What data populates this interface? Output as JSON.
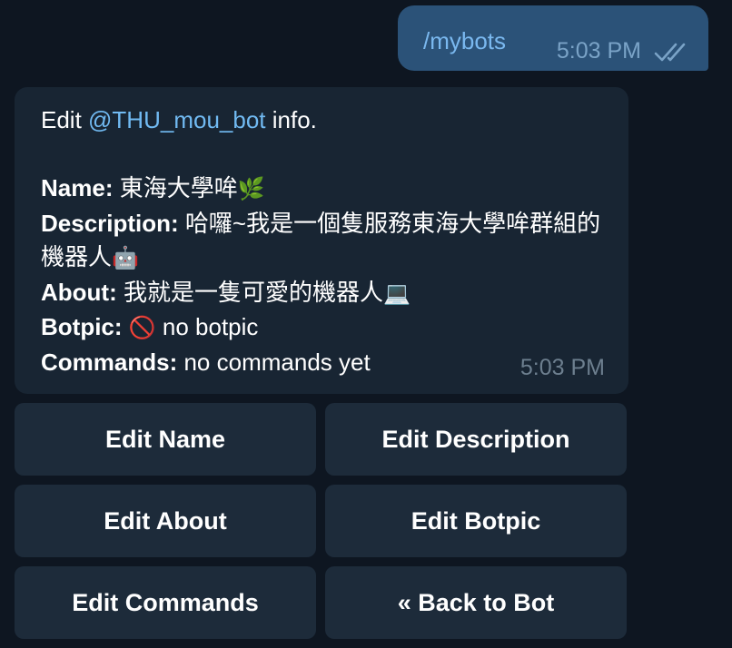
{
  "outgoing": {
    "text": "/mybots",
    "time": "5:03 PM",
    "status_icon": "double-check-icon"
  },
  "incoming": {
    "intro_prefix": "Edit ",
    "mention": "@THU_mou_bot",
    "intro_suffix": " info.",
    "name_label": "Name:",
    "name_value": " 東海大學哞",
    "name_emoji": "🌿",
    "description_label": "Description:",
    "description_value": " 哈囉~我是一個隻服務東海大學哞群組的機器人",
    "description_emoji": "🤖",
    "about_label": "About:",
    "about_value": " 我就是一隻可愛的機器人",
    "about_emoji": "💻",
    "botpic_label": "Botpic:",
    "botpic_emoji": "🚫",
    "botpic_value": " no botpic",
    "commands_label": "Commands:",
    "commands_value": " no commands yet",
    "time": "5:03 PM"
  },
  "keyboard": {
    "edit_name": "Edit Name",
    "edit_description": "Edit Description",
    "edit_about": "Edit About",
    "edit_botpic": "Edit Botpic",
    "edit_commands": "Edit Commands",
    "back_to_bot": "« Back to Bot"
  },
  "colors": {
    "background": "#0e1621",
    "outgoing_bubble": "#2b5278",
    "incoming_bubble": "#182533",
    "keyboard_button": "#1d2b3a",
    "link": "#71baf2"
  }
}
